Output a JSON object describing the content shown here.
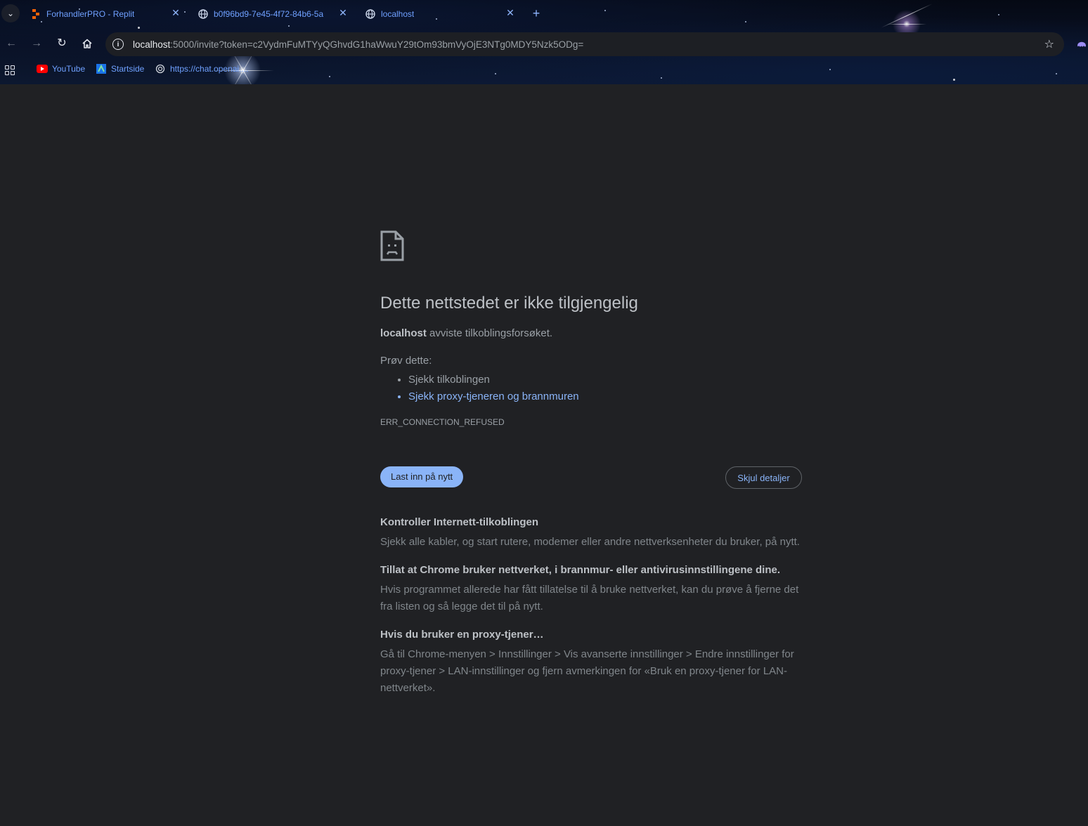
{
  "browser": {
    "tabs": [
      {
        "title": "ForhandlerPRO - Replit",
        "favicon": "replit-icon",
        "active": false
      },
      {
        "title": "b0f96bd9-7e45-4f72-84b6-5a",
        "favicon": "globe-icon",
        "active": false
      },
      {
        "title": "localhost",
        "favicon": "globe-icon",
        "active": true
      }
    ],
    "url": {
      "host": "localhost",
      "rest": ":5000/invite?token=c2VydmFuMTYyQGhvdG1haWwuY29tOm93bmVyOjE3NTg0MDY5Nzk5ODg="
    },
    "bookmarks": [
      {
        "label": "YouTube",
        "icon": "youtube-icon"
      },
      {
        "label": "Startside",
        "icon": "startside-icon"
      },
      {
        "label": "https://chat.openai....",
        "icon": "openai-icon"
      }
    ],
    "colors": {
      "link": "#6fa0ff",
      "accent": "#8ab4f8",
      "page_bg": "#202124"
    }
  },
  "error_page": {
    "headline": "Dette nettstedet er ikke tilgjengelig",
    "summary_host": "localhost",
    "summary_text": " avviste tilkoblingsforsøket.",
    "try_label": "Prøv dette:",
    "suggestions": [
      "Sjekk tilkoblingen",
      "Sjekk proxy-tjeneren og brannmuren"
    ],
    "error_code": "ERR_CONNECTION_REFUSED",
    "reload_button": "Last inn på nytt",
    "details_button": "Skjul detaljer",
    "details": [
      {
        "title": "Kontroller Internett-tilkoblingen",
        "text": "Sjekk alle kabler, og start rutere, modemer eller andre nettverksenheter du bruker, på nytt."
      },
      {
        "title": "Tillat at Chrome bruker nettverket, i brannmur- eller antivirusinnstillingene dine.",
        "text": "Hvis programmet allerede har fått tillatelse til å bruke nettverket, kan du prøve å fjerne det fra listen og så legge det til på nytt."
      },
      {
        "title": "Hvis du bruker en proxy-tjener…",
        "text": "Gå til Chrome-menyen > Innstillinger > Vis avanserte innstillinger > Endre innstillinger for proxy-tjener > LAN-innstillinger og fjern avmerkingen for «Bruk en proxy-tjener for LAN-nettverket»."
      }
    ]
  }
}
